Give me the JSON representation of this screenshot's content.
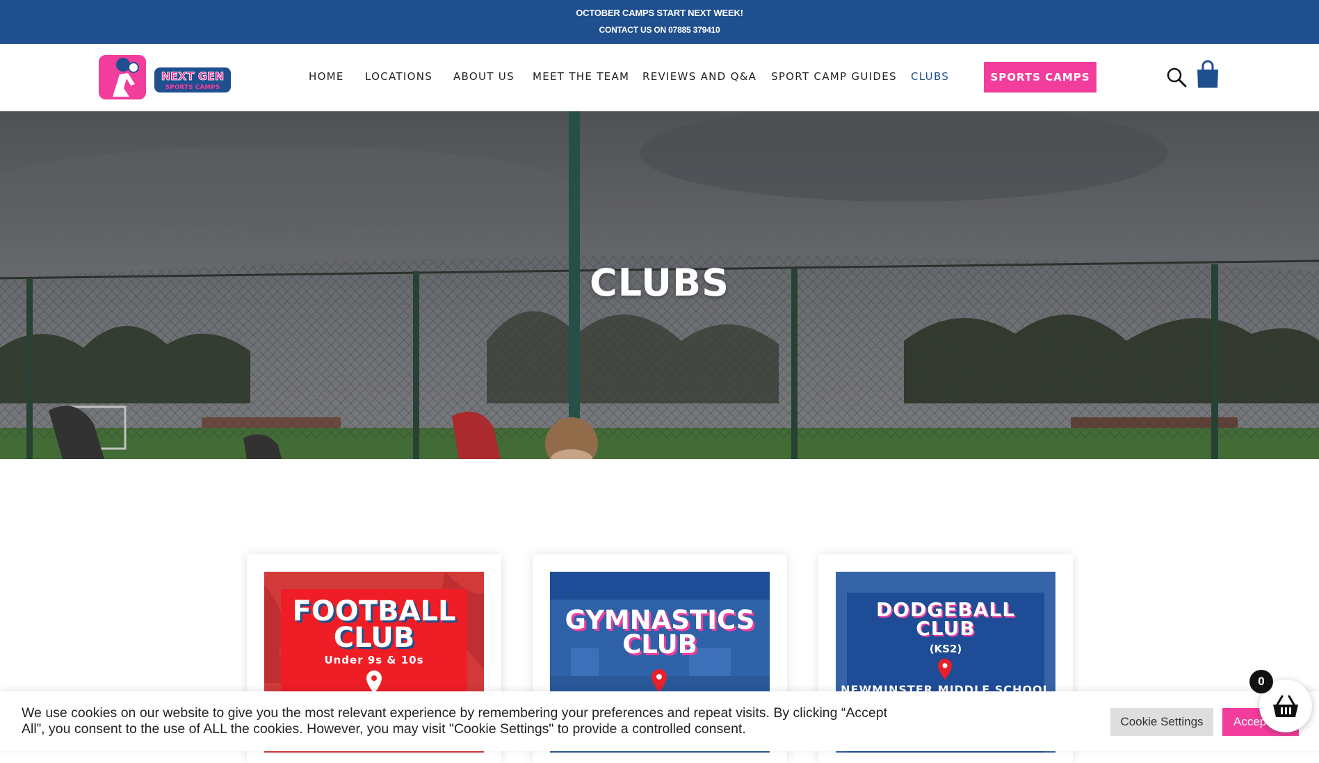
{
  "topbar": {
    "line1": "OCTOBER CAMPS START NEXT WEEK!",
    "line2": "CONTACT US ON 07885 379410"
  },
  "logo": {
    "line1": "NEXT GEN",
    "line2": "SPORTS CAMPS"
  },
  "nav": {
    "items": [
      {
        "label": "HOME"
      },
      {
        "label": "LOCATIONS"
      },
      {
        "label": "ABOUT US"
      },
      {
        "label": "MEET THE TEAM"
      },
      {
        "label": "REVIEWS AND Q&A"
      },
      {
        "label": "SPORT CAMP GUIDES"
      },
      {
        "label": "CLUBS",
        "active": true
      }
    ],
    "cta_label": "SPORTS CAMPS"
  },
  "icons": {
    "search": "search-icon",
    "bag": "shopping-bag-icon",
    "cart": "basket-icon",
    "pin": "map-pin-icon"
  },
  "hero": {
    "title": "CLUBS"
  },
  "clubs": [
    {
      "title_line1": "FOOTBALL",
      "title_line2": "CLUB",
      "subtitle": "Under 9s & 10s"
    },
    {
      "title_line1": "GYMNASTICS",
      "title_line2": "CLUB"
    },
    {
      "title_line1": "DODGEBALL",
      "title_line2": "CLUB",
      "subtitle": "(KS2)",
      "location": "NEWMINSTER MIDDLE SCHOOL"
    }
  ],
  "cookie": {
    "text": "We use cookies on our website to give you the most relevant experience by remembering your preferences and repeat visits. By clicking “Accept All”, you consent to the use of ALL the cookies. However, you may visit \"Cookie Settings\" to provide a controlled consent.",
    "settings_label": "Cookie Settings",
    "accept_label": "Accept All"
  },
  "cart": {
    "count": "0"
  },
  "colors": {
    "brand_blue": "#1f4f8f",
    "brand_pink": "#f23d9c",
    "football_red": "#e8202a",
    "poster_blue": "#1e4c96"
  }
}
